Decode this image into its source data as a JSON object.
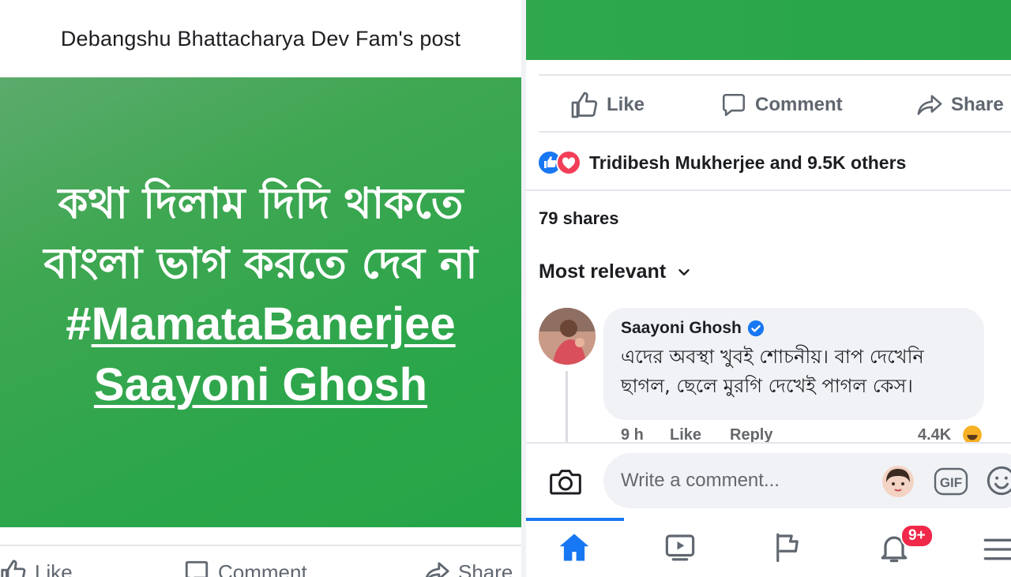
{
  "left_post": {
    "header_title": "Debangshu Bhattacharya Dev Fam's post",
    "bengali_line_1": "কথা দিলাম দিদি থাকতে",
    "bengali_line_2": "বাংলা ভাগ করতে দেব না",
    "hashtag_prefix": "#",
    "hashtag_1": "MamataBanerjee",
    "hashtag_2": "Saayoni Ghosh",
    "background_color": "#2ba64a"
  },
  "post_actions": {
    "like_label": "Like",
    "comment_label": "Comment",
    "share_label": "Share"
  },
  "reactions": {
    "summary": "Tridibesh Mukherjee and 9.5K others",
    "like_color": "#1877f2",
    "love_color": "#f33e58"
  },
  "shares": {
    "label": "79 shares"
  },
  "sort": {
    "label": "Most relevant"
  },
  "comment": {
    "author": "Saayoni Ghosh",
    "verified": true,
    "text_line_1": "এদের অবস্থা খুবই শোচনীয়। বাপ দেখেনি",
    "text_line_2": "ছাগল, ছেলে মুরগি দেখেই পাগল কেস।",
    "time": "9 h",
    "like_label": "Like",
    "reply_label": "Reply",
    "reaction_count": "4.4K"
  },
  "composer": {
    "placeholder": "Write a comment...",
    "gif_label": "GIF"
  },
  "tabbar": {
    "notification_badge": "9+",
    "active_color": "#1877f2"
  }
}
